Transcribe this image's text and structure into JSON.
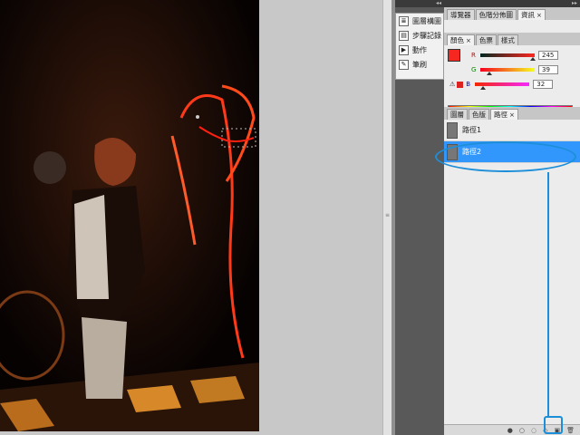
{
  "mini_panel": {
    "items": [
      {
        "label": "圖層構圖",
        "icon": "layer-comps-icon"
      },
      {
        "label": "步驟記錄",
        "icon": "history-icon"
      },
      {
        "label": "動作",
        "icon": "actions-icon"
      },
      {
        "label": "筆刷",
        "icon": "brush-icon"
      }
    ]
  },
  "top_tabs": [
    "導覽器",
    "色階分佈圖",
    "資訊"
  ],
  "color_tabs": [
    "顏色",
    "色票",
    "樣式"
  ],
  "color": {
    "r_label": "R",
    "r_value": "245",
    "g_label": "G",
    "g_value": "39",
    "b_label": "B",
    "b_value": "32",
    "fg_color": "#f52720",
    "bg_color": "#000000"
  },
  "layer_tabs": [
    "圖層",
    "色版",
    "路徑"
  ],
  "paths": [
    {
      "name": "路徑1",
      "selected": false
    },
    {
      "name": "路徑2",
      "selected": true
    }
  ],
  "bottom_icons": [
    "fill-path-icon",
    "stroke-path-icon",
    "load-selection-icon",
    "make-work-path-icon",
    "new-path-icon",
    "delete-path-icon"
  ],
  "highlight_color": "#1c8fd8"
}
